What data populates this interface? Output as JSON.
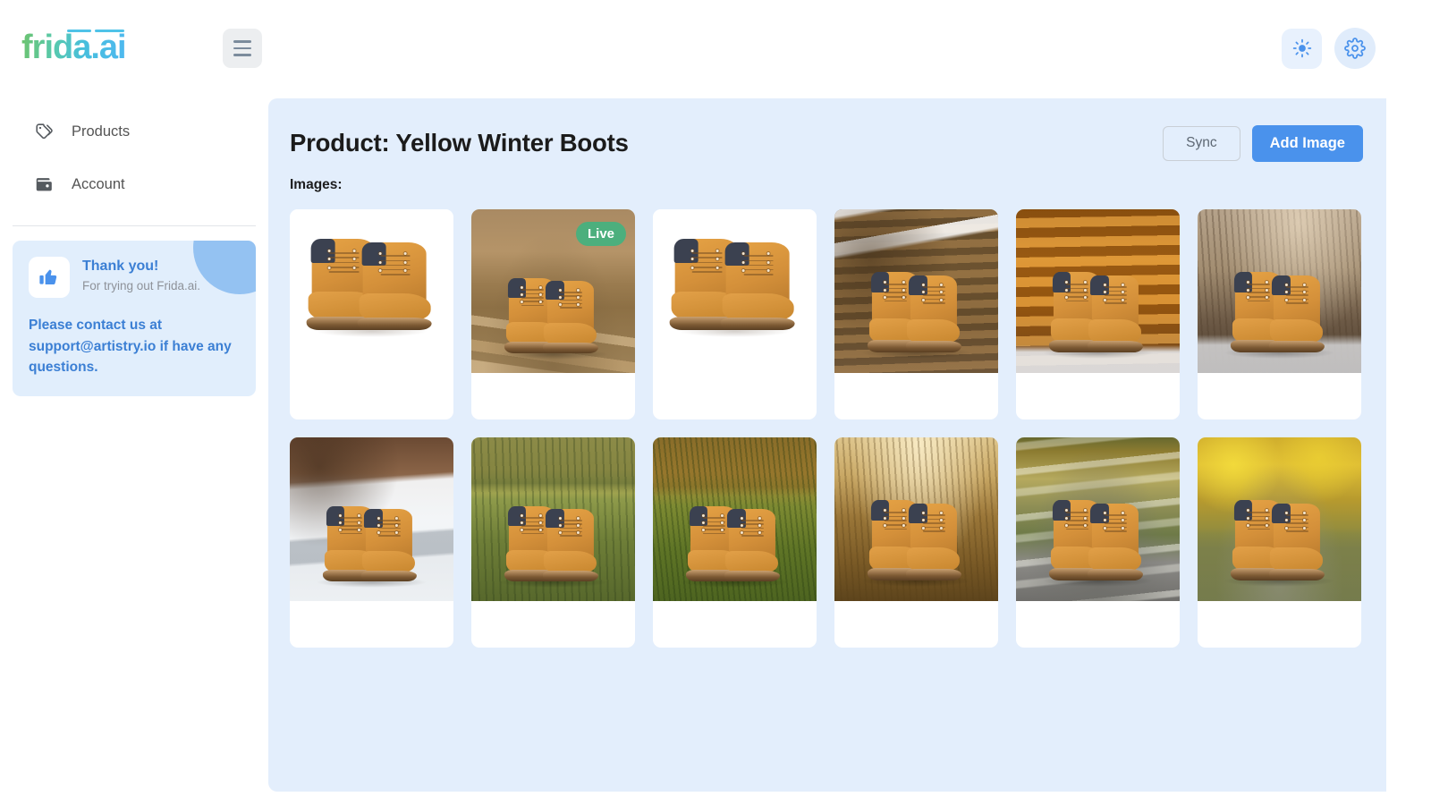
{
  "brand": {
    "name": "frida.ai"
  },
  "topbar": {
    "menu_icon": "hamburger-icon",
    "theme_toggle_icon": "sun-icon",
    "settings_icon": "gear-icon"
  },
  "sidebar": {
    "items": [
      {
        "label": "Products",
        "icon": "tags-icon"
      },
      {
        "label": "Account",
        "icon": "wallet-icon"
      }
    ],
    "promo": {
      "icon": "thumbs-up-icon",
      "title": "Thank you!",
      "subtitle": "For trying out Frida.ai.",
      "body": "Please contact us at support@artistry.io if have any questions."
    }
  },
  "main": {
    "title": "Product: Yellow Winter Boots",
    "sync_label": "Sync",
    "add_image_label": "Add Image",
    "images_label": "Images:",
    "live_badge_label": "Live",
    "images": [
      {
        "alt": "Yellow winter boots on plain white studio background",
        "live": false,
        "raised": false,
        "scene": "studio"
      },
      {
        "alt": "Yellow winter boots on gravel by stacked lumber",
        "live": true,
        "raised": false,
        "scene": "lumber"
      },
      {
        "alt": "Yellow winter boots on plain white studio background",
        "live": false,
        "raised": false,
        "scene": "studio"
      },
      {
        "alt": "Yellow winter boots beside snowy log cabin",
        "live": false,
        "raised": true,
        "scene": "cabin"
      },
      {
        "alt": "Yellow winter boots against orange log wall with snow",
        "live": false,
        "raised": true,
        "scene": "logwall"
      },
      {
        "alt": "Yellow winter boots in snowy sepia field",
        "live": false,
        "raised": true,
        "scene": "sepiafield"
      },
      {
        "alt": "Yellow winter boots on snow covered steps by house",
        "live": false,
        "raised": false,
        "scene": "steps"
      },
      {
        "alt": "Yellow winter boots in golden meadow at sunset",
        "live": false,
        "raised": false,
        "scene": "meadow"
      },
      {
        "alt": "Yellow winter boots in tall green grass by autumn trees",
        "live": false,
        "raised": false,
        "scene": "grass"
      },
      {
        "alt": "Yellow winter boots in golden dry field haze",
        "live": false,
        "raised": true,
        "scene": "dryfield"
      },
      {
        "alt": "Yellow winter boots on stones beside autumn lake",
        "live": false,
        "raised": true,
        "scene": "lake"
      },
      {
        "alt": "Yellow winter boots on rock amid yellow autumn foliage",
        "live": false,
        "raised": true,
        "scene": "foliage"
      }
    ]
  },
  "colors": {
    "accent": "#4a92ec",
    "panel_bg": "#e3eefc",
    "promo_bg": "#e1eefc",
    "promo_text": "#3b7fd4",
    "live_badge": "#4caf7d",
    "logo_gradient_start": "#6dc36d",
    "logo_gradient_end": "#4fb9f0"
  }
}
